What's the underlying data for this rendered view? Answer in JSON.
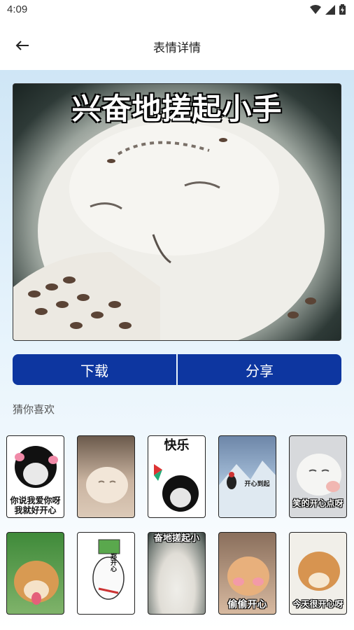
{
  "status_bar": {
    "time": "4:09"
  },
  "header": {
    "title": "表情详情"
  },
  "hero": {
    "caption": "兴奋地搓起小手"
  },
  "actions": {
    "download_label": "下载",
    "share_label": "分享"
  },
  "recommend": {
    "title": "猜你喜欢",
    "items": [
      {
        "caption": "你说我爱你呀\n我就好开心"
      },
      {
        "caption": ""
      },
      {
        "caption": "快乐"
      },
      {
        "caption": "开心到起"
      },
      {
        "caption": "笑的开心点呀"
      },
      {
        "caption": ""
      },
      {
        "caption": "郑开心"
      },
      {
        "caption": "奋地搓起小"
      },
      {
        "caption": "偷偷开心"
      },
      {
        "caption": "今天很开心呀"
      }
    ]
  },
  "colors": {
    "primary_button": "#0d36a0",
    "gradient_top": "#cfe6f6"
  }
}
